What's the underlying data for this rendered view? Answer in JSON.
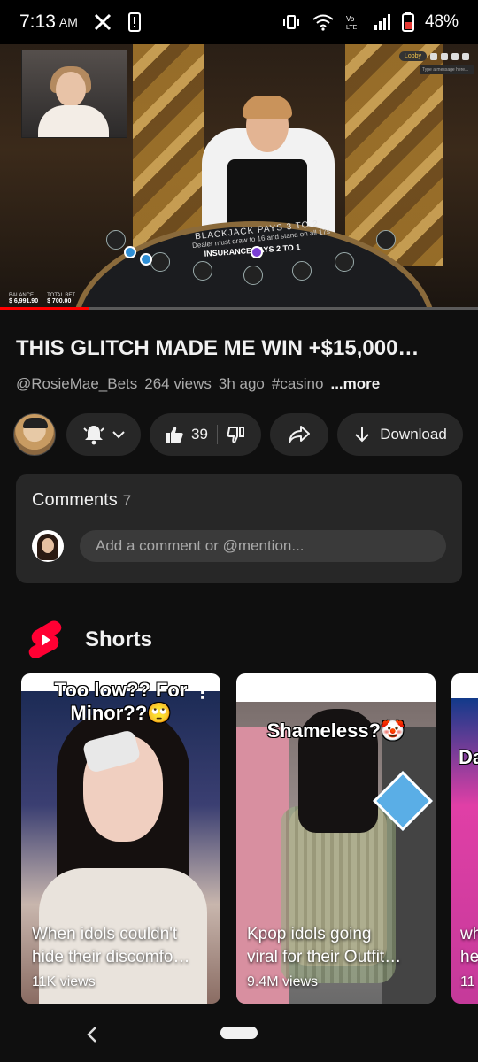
{
  "status_bar": {
    "time": "7:13",
    "ampm": "AM",
    "battery": "48%"
  },
  "video": {
    "table_line1": "BLACKJACK PAYS 3 TO 2",
    "table_line2": "Dealer must draw to 16 and stand on all 17s",
    "table_line3": "INSURANCE PAYS 2 TO 1",
    "lobby_label": "Lobby",
    "message_placeholder": "Type a message here...",
    "balance_label": "BALANCE",
    "balance_value": "$ 6,991.90",
    "total_bet_label": "TOTAL BET",
    "total_bet_value": "$ 700.00",
    "progress": 0.185
  },
  "title": "THIS GLITCH MADE ME WIN +$15,000…",
  "meta": {
    "channel": "@RosieMae_Bets",
    "views": "264 views",
    "age": "3h ago",
    "hashtag": "#casino",
    "more": "...more"
  },
  "actions": {
    "like_count": "39",
    "download_label": "Download"
  },
  "comments": {
    "label": "Comments",
    "count": "7",
    "placeholder": "Add a comment or @mention..."
  },
  "shorts": {
    "title": "Shorts",
    "items": [
      {
        "overlay_line1": "Too low?? For",
        "overlay_line2": "Minor??🙄",
        "caption_line1": "When idols couldn't",
        "caption_line2": "hide their discomfo…",
        "views": "11K views"
      },
      {
        "overlay_line1": "Shameless?🤡",
        "caption_line1": "Kpop idols going",
        "caption_line2": "viral for their Outfit…",
        "views": "9.4M views"
      },
      {
        "overlay_line1": "Da",
        "caption_line1": "wh",
        "caption_line2": "he",
        "views": "11"
      }
    ]
  },
  "colors": {
    "background": "#0f0f0f",
    "surface": "#272727",
    "accent_red": "#ff0000",
    "secondary_text": "#aaaaaa"
  }
}
